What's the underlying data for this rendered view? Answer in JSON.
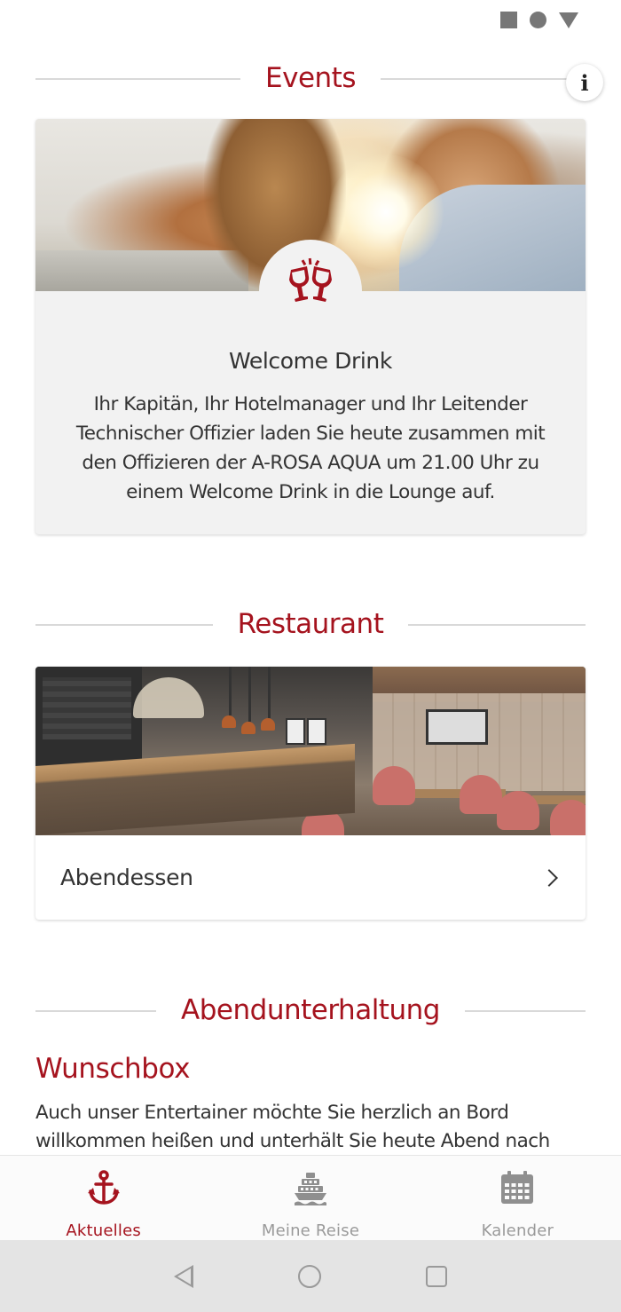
{
  "status_bar": {
    "icons": [
      "square-icon",
      "circle-icon",
      "triangle-icon"
    ]
  },
  "events": {
    "heading": "Events",
    "info_label": "i",
    "card": {
      "icon": "wine-glasses-toast-icon",
      "title": "Welcome Drink",
      "description": "Ihr Kapitän, Ihr Hotelmanager und Ihr Leitender Technischer Offizier laden Sie heute zusammen mit den Offizieren der A-ROSA AQUA um 21.00 Uhr zu einem Welcome Drink in die Lounge auf."
    }
  },
  "restaurant": {
    "heading": "Restaurant",
    "item_label": "Abendessen"
  },
  "entertainment": {
    "heading": "Abendunterhaltung",
    "subheading": "Wunschbox",
    "text": "Auch unser Entertainer möchte Sie herzlich an Bord willkommen heißen und unterhält Sie heute Abend nach dem"
  },
  "bottom_nav": {
    "items": [
      {
        "label": "Aktuelles",
        "icon": "anchor-icon",
        "active": true
      },
      {
        "label": "Meine Reise",
        "icon": "ship-icon",
        "active": false
      },
      {
        "label": "Kalender",
        "icon": "calendar-icon",
        "active": false
      }
    ]
  },
  "colors": {
    "accent": "#a5131e",
    "inactive": "#9a9a9a",
    "card_bg": "#f2f2f2"
  }
}
